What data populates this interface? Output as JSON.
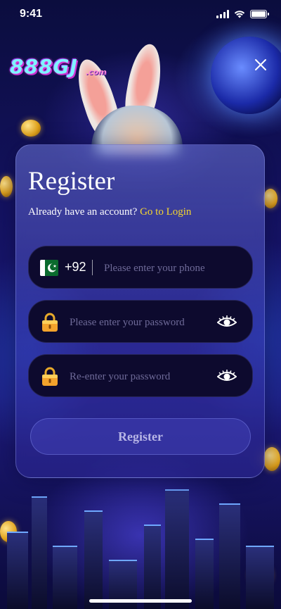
{
  "status_bar": {
    "time": "9:41"
  },
  "brand": {
    "logo_text": "888GJ",
    "logo_suffix": ".com"
  },
  "icons": {
    "close": "close-icon",
    "flag": "pakistan-flag-icon",
    "lock": "lock-icon",
    "eye": "eye-icon"
  },
  "form": {
    "title": "Register",
    "login_prompt": "Already have an account?",
    "login_link": "Go to Login",
    "phone": {
      "country_code": "+92",
      "value": "",
      "placeholder": "Please enter your phone"
    },
    "password": {
      "value": "",
      "placeholder": "Please enter your password"
    },
    "confirm_password": {
      "value": "",
      "placeholder": "Re-enter your password"
    },
    "submit_label": "Register"
  },
  "colors": {
    "accent_link": "#f5d630",
    "field_background": "#0d0a2e",
    "placeholder": "#6e6a98",
    "button_text": "#b8b6e6"
  }
}
